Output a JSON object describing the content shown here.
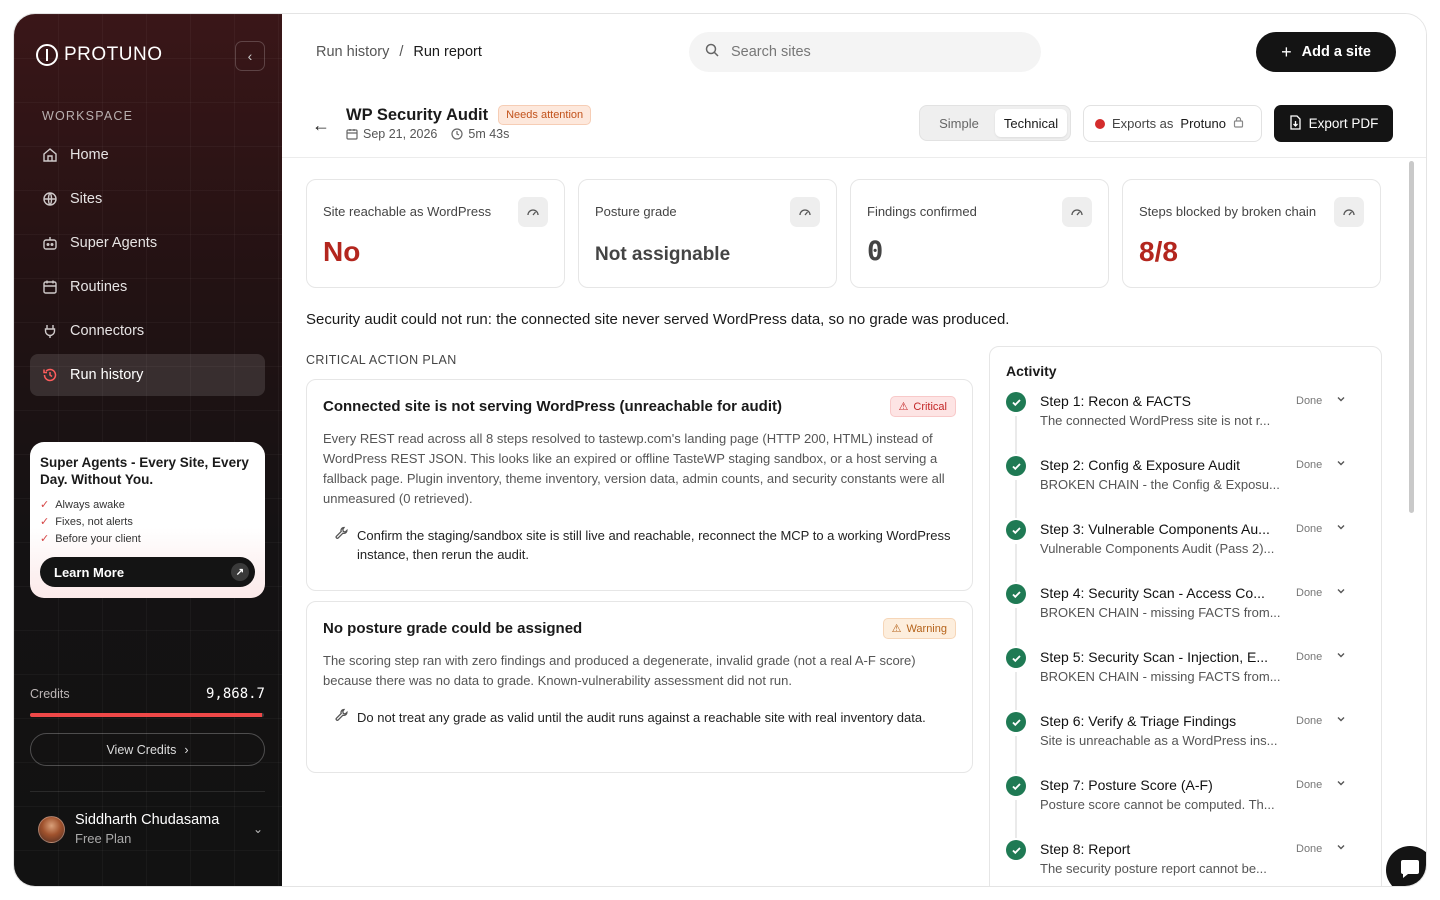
{
  "brand": {
    "name": "PROTUNO"
  },
  "sidebar": {
    "section_label": "WORKSPACE",
    "items": [
      {
        "label": "Home",
        "icon": "home-icon"
      },
      {
        "label": "Sites",
        "icon": "globe-icon"
      },
      {
        "label": "Super Agents",
        "icon": "robot-icon"
      },
      {
        "label": "Routines",
        "icon": "calendar-icon"
      },
      {
        "label": "Connectors",
        "icon": "plug-icon"
      },
      {
        "label": "Run history",
        "icon": "history-icon",
        "active": true
      }
    ],
    "promo": {
      "title": "Super Agents - Every Site, Every Day. Without You.",
      "points": [
        "Always awake",
        "Fixes, not alerts",
        "Before your client"
      ],
      "button": "Learn More"
    },
    "credits": {
      "label": "Credits",
      "value": "9,868.7",
      "fill_percent": 99,
      "button": "View Credits"
    },
    "user": {
      "name": "Siddharth Chudasama",
      "plan": "Free Plan"
    }
  },
  "header": {
    "breadcrumb": [
      "Run history",
      "Run report"
    ],
    "search_placeholder": "Search sites",
    "add_site": "Add a site"
  },
  "report": {
    "title": "WP Security Audit",
    "status_badge": "Needs attention",
    "date": "Sep 21, 2026",
    "duration": "5m 43s",
    "view_toggle": [
      "Simple",
      "Technical"
    ],
    "exports_label": "Exports as",
    "exports_brand": "Protuno",
    "export_button": "Export PDF"
  },
  "stats": [
    {
      "label": "Site reachable as WordPress",
      "value": "No"
    },
    {
      "label": "Posture grade",
      "value": "Not assignable"
    },
    {
      "label": "Findings confirmed",
      "value": "0"
    },
    {
      "label": "Steps blocked by broken chain",
      "value": "8/8"
    }
  ],
  "summary": "Security audit could not run: the connected site never served WordPress data, so no grade was produced.",
  "action_plan": {
    "title": "CRITICAL ACTION PLAN",
    "items": [
      {
        "title": "Connected site is not serving WordPress (unreachable for audit)",
        "severity": "Critical",
        "body": "Every REST read across all 8 steps resolved to tastewp.com's landing page (HTTP 200, HTML) instead of WordPress REST JSON. This looks like an expired or offline TasteWP staging sandbox, or a host serving a fallback page. Plugin inventory, theme inventory, version data, admin counts, and security constants were all unmeasured (0 retrieved).",
        "action": "Confirm the staging/sandbox site is still live and reachable, reconnect the MCP to a working WordPress instance, then rerun the audit."
      },
      {
        "title": "No posture grade could be assigned",
        "severity": "Warning",
        "body": "The scoring step ran with zero findings and produced a degenerate, invalid grade (not a real A-F score) because there was no data to grade. Known-vulnerability assessment did not run.",
        "action": "Do not treat any grade as valid until the audit runs against a reachable site with real inventory data."
      }
    ]
  },
  "activity": {
    "title": "Activity",
    "steps": [
      {
        "title": "Step 1: Recon & FACTS",
        "desc": "The connected WordPress site is not r...",
        "status": "Done"
      },
      {
        "title": "Step 2: Config & Exposure Audit",
        "desc": "BROKEN CHAIN - the Config & Exposu...",
        "status": "Done"
      },
      {
        "title": "Step 3: Vulnerable Components Au...",
        "desc": "Vulnerable Components Audit (Pass 2)...",
        "status": "Done"
      },
      {
        "title": "Step 4: Security Scan - Access Co...",
        "desc": "BROKEN CHAIN - missing FACTS from...",
        "status": "Done"
      },
      {
        "title": "Step 5: Security Scan - Injection, E...",
        "desc": "BROKEN CHAIN - missing FACTS from...",
        "status": "Done"
      },
      {
        "title": "Step 6: Verify & Triage Findings",
        "desc": "Site is unreachable as a WordPress ins...",
        "status": "Done"
      },
      {
        "title": "Step 7: Posture Score (A-F)",
        "desc": "Posture score cannot be computed. Th...",
        "status": "Done"
      },
      {
        "title": "Step 8: Report",
        "desc": "The security posture report cannot be...",
        "status": "Done"
      }
    ]
  },
  "colors": {
    "accent": "#ef4848",
    "critical": "#b3261e",
    "success": "#1f7a54",
    "dark": "#141414"
  }
}
